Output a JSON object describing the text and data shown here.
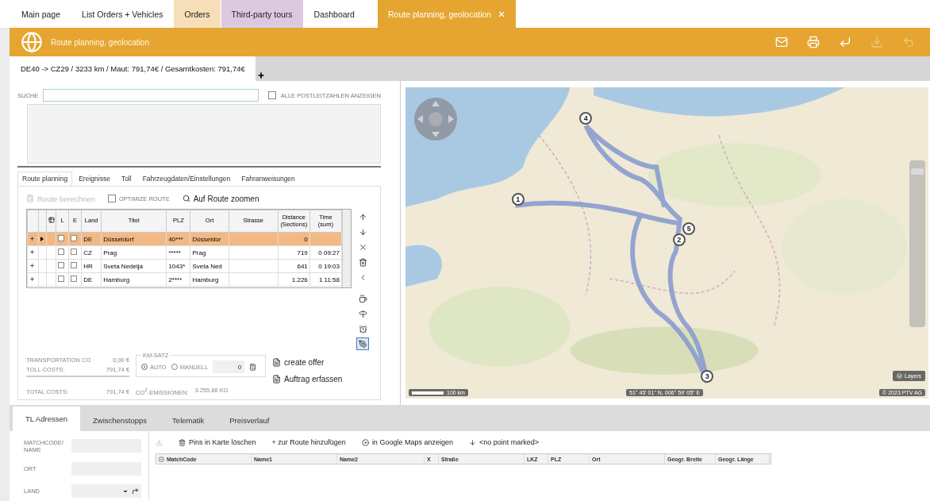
{
  "app_tabs": [
    {
      "label": "Main page",
      "selected": false,
      "color": "#ffffff"
    },
    {
      "label": "List Orders + Vehicles",
      "selected": false,
      "color": "#ffffff"
    },
    {
      "label": "Orders",
      "selected": false,
      "color": "#f6dfb8"
    },
    {
      "label": "Third-party tours",
      "selected": false,
      "color": "#ddc9df"
    },
    {
      "label": "Dashboard",
      "selected": false,
      "color": "#ffffff"
    },
    {
      "label": "Route planning, geolocation",
      "selected": true,
      "color": "#e5a530",
      "closable": true
    }
  ],
  "header": {
    "title": "Route planning, geolocation",
    "actions": [
      {
        "kind": "mail",
        "disabled": false
      },
      {
        "kind": "print",
        "disabled": false
      },
      {
        "kind": "transfer",
        "disabled": false
      },
      {
        "kind": "download",
        "disabled": true
      },
      {
        "kind": "undo",
        "disabled": true
      }
    ]
  },
  "route_tab": {
    "label": "DE40 -> CZ29 / 3233 km / Maut: 791,74€ / Gesamtkosten: 791,74€",
    "selected": true
  },
  "search": {
    "label": "SUCHE",
    "checkbox": {
      "label": "ALLE POSTLEITZAHLEN ANZEIGEN",
      "checked": false
    }
  },
  "route_tabs": [
    {
      "label": "Route planning",
      "selected": true
    },
    {
      "label": "Ereignisse",
      "selected": false
    },
    {
      "label": "Toll",
      "selected": false
    },
    {
      "label": "Fahrzeugdaten/Einstellungen",
      "selected": false
    },
    {
      "label": "Fahranweisungen",
      "selected": false
    }
  ],
  "route_toolbar": {
    "calculate": {
      "label": "Route berechnen",
      "disabled": true
    },
    "optimize": {
      "label": "OPTIMIZE ROUTE",
      "checked": false
    },
    "zoom": {
      "label": "Auf Route zoomen"
    }
  },
  "stops_table": {
    "columns": [
      "L",
      "E",
      "Land",
      "Titel",
      "PLZ",
      "Ort",
      "Strasse",
      "Distance (Sections)",
      "Time (sum)"
    ],
    "rows": [
      {
        "selected": true,
        "l": false,
        "e": false,
        "land": "DE",
        "titel": "Düsseldorf",
        "plz": "40***",
        "ort": "Düsseldor",
        "distance": "0"
      },
      {
        "selected": false,
        "l": false,
        "e": false,
        "land": "CZ",
        "titel": "Prag",
        "plz": "*****",
        "ort": "Prag",
        "distance": "719",
        "time": "0 09:27"
      },
      {
        "selected": false,
        "l": false,
        "e": false,
        "land": "HR",
        "titel": "Sveta Nedelja",
        "plz": "1043*",
        "ort": "Sveta Ned",
        "distance": "641",
        "time": "0 19:03"
      },
      {
        "selected": false,
        "l": false,
        "e": false,
        "land": "DE",
        "titel": "Hamburg",
        "plz": "2****",
        "ort": "Hamburg",
        "distance": "1.226",
        "time": "1 11:58"
      }
    ]
  },
  "side_tools": [
    {
      "kind": "up",
      "active": false
    },
    {
      "kind": "down",
      "active": false
    },
    {
      "kind": "remove",
      "active": false
    },
    {
      "kind": "delete",
      "active": false
    },
    {
      "kind": "back",
      "active": false
    },
    {
      "kind": "cup",
      "active": false
    },
    {
      "kind": "signpost",
      "active": false
    },
    {
      "kind": "alarm",
      "active": false
    },
    {
      "kind": "pen",
      "active": true
    }
  ],
  "costs": {
    "transportation": {
      "label": "TRANSPORTATION CO",
      "value": "0,00 €"
    },
    "toll": {
      "label": "TOLL COSTS:",
      "value": "791,74 €"
    },
    "total": {
      "label": "TOTAL COSTS:",
      "value": "791,74 €"
    },
    "km_satz": {
      "label": "KM-SATZ",
      "options": [
        {
          "label": "AUTO",
          "selected": true
        },
        {
          "label": "MANUELL",
          "selected": false
        }
      ],
      "value": "0"
    },
    "co2": {
      "label": "CO$^{2}$-EMISSIONEN:",
      "value": "3.255,86 KG"
    },
    "actions": [
      "create offer",
      "Auftrag erfassen"
    ]
  },
  "map": {
    "kind": "picture",
    "zoom": {
      "level": 0.95
    },
    "markers": [
      "4",
      "1",
      "5",
      "2",
      "3"
    ],
    "scale": "100 km",
    "coordinates": "51° 45' 01\" N, 006° 59' 05\" E",
    "copyright": "© 2023 PTV AG",
    "layers": "Layers"
  },
  "bottom": {
    "tabs": [
      {
        "label": "TL Adressen",
        "selected": true
      },
      {
        "label": "Zwischenstopps",
        "selected": false
      },
      {
        "label": "Telematik",
        "selected": false
      },
      {
        "label": "Preisverlauf",
        "selected": false
      }
    ],
    "fields": [
      {
        "label": "MATCHCODE/ NAME",
        "kind": "text"
      },
      {
        "label": "ORT",
        "kind": "text"
      },
      {
        "label": "LAND",
        "kind": "select"
      }
    ],
    "actions": [
      {
        "kind": "import",
        "disabled": true
      },
      {
        "kind": "trash",
        "label": "Pins in Karte löschen",
        "disabled": false
      },
      {
        "kind": "plain",
        "label": "+ zur Route hinzufügen",
        "disabled": false
      },
      {
        "kind": "radio",
        "label": "in Google Maps anzeigen",
        "disabled": false
      },
      {
        "kind": "arrow",
        "label": "<no point marked>",
        "disabled": false
      }
    ],
    "columns": [
      "MatchCode",
      "Name1",
      "Name2",
      "X",
      "Straße",
      "LKZ",
      "PLZ",
      "Ort",
      "Geogr. Breite",
      "Geogr. Länge"
    ]
  }
}
